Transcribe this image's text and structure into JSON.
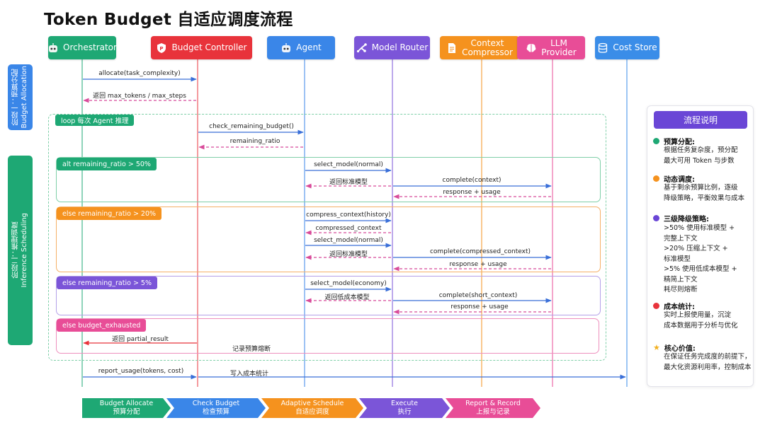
{
  "title": "Token Budget 自适应调度流程",
  "colors": {
    "orchestrator": "#1ea874",
    "budget_controller": "#e8333b",
    "agent": "#3a86e8",
    "model_router": "#7b55d8",
    "context_compressor": "#f5921e",
    "llm_provider": "#e84d97",
    "cost_store": "#3a8de8"
  },
  "actors": [
    {
      "name": "Orchestrator",
      "icon": "robot-icon"
    },
    {
      "name": "Budget Controller",
      "icon": "shield-icon"
    },
    {
      "name": "Agent",
      "icon": "robot-icon"
    },
    {
      "name": "Model Router",
      "icon": "router-icon"
    },
    {
      "name": "Context\nCompressor",
      "icon": "document-icon"
    },
    {
      "name": "LLM\nProvider",
      "icon": "brain-icon"
    },
    {
      "name": "Cost Store",
      "icon": "database-icon"
    }
  ],
  "phases": [
    {
      "label": "阶段一：预算分配\nBudget Allocation"
    },
    {
      "label": "阶段二：推理调度\nInference Scheduling"
    }
  ],
  "frames": {
    "loop": "loop   每次 Agent 推理",
    "alt": "alt   remaining_ratio > 50%",
    "else1": "else   remaining_ratio > 20%",
    "else2": "else   remaining_ratio > 5%",
    "else3": "else   budget_exhausted"
  },
  "messages": {
    "allocate": "allocate(task_complexity)",
    "return_max": "返回 max_tokens / max_steps",
    "check_budget": "check_remaining_budget()",
    "remaining_ratio": "remaining_ratio",
    "select_normal_1": "select_model(normal)",
    "return_std_1": "返回标准模型",
    "complete_context": "complete(context)",
    "response_usage_1": "response + usage",
    "compress_context": "compress_context(history)",
    "compressed_context": "compressed_context",
    "select_normal_2": "select_model(normal)",
    "return_std_2": "返回标准模型",
    "complete_compressed": "complete(compressed_context)",
    "response_usage_2": "response + usage",
    "select_economy": "select_model(economy)",
    "return_low": "返回低成本模型",
    "complete_short": "complete(short_context)",
    "response_usage_3": "response + usage",
    "return_partial": "返回 partial_result",
    "record_fuse": "记录预算熔断",
    "report_usage": "report_usage(tokens, cost)",
    "write_cost": "写入成本统计"
  },
  "panel": {
    "title": "流程说明",
    "sections": [
      {
        "color": "#1ea874",
        "shape": "dot",
        "head": "预算分配:",
        "lines": [
          "根据任务复杂度，预分配",
          "最大可用 Token 与步数"
        ]
      },
      {
        "color": "#f5921e",
        "shape": "dot",
        "head": "动态调度:",
        "lines": [
          "基于剩余预算比例，逐级",
          "降级策略，平衡效果与成本"
        ]
      },
      {
        "color": "#6a46d6",
        "shape": "dot",
        "head": "三级降级策略:",
        "lines": [
          ">50%  使用标准模型 +",
          "完整上下文",
          ">20%  压缩上下文 +",
          "标准模型",
          ">5%  使用低成本模型 +",
          "精简上下文",
          "耗尽则熔断"
        ]
      },
      {
        "color": "#e8333b",
        "shape": "dot",
        "head": "成本统计:",
        "lines": [
          "实时上报使用量，沉淀",
          "成本数据用于分析与优化"
        ]
      },
      {
        "color": "#f2b01e",
        "shape": "star",
        "head": "核心价值:",
        "lines": [
          "在保证任务完成度的前提下，",
          "最大化资源利用率，控制成本"
        ]
      }
    ]
  },
  "steps": [
    {
      "en": "Budget Allocate",
      "zh": "预算分配",
      "color": "#1ea874"
    },
    {
      "en": "Check Budget",
      "zh": "检查预算",
      "color": "#3a86e8"
    },
    {
      "en": "Adaptive Schedule",
      "zh": "自适应调度",
      "color": "#f5921e"
    },
    {
      "en": "Execute",
      "zh": "执行",
      "color": "#7b55d8"
    },
    {
      "en": "Report & Record",
      "zh": "上报与记录",
      "color": "#e84d97"
    }
  ]
}
